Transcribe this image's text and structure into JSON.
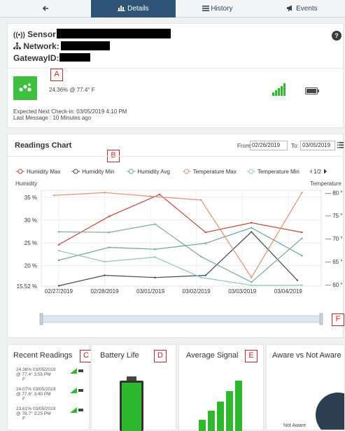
{
  "tabs": [
    {
      "label": "",
      "icon": "back-arrow-icon"
    },
    {
      "label": "Details",
      "icon": "bar-chart-icon"
    },
    {
      "label": "History",
      "icon": "list-icon"
    },
    {
      "label": "Events",
      "icon": "megaphone-icon"
    }
  ],
  "header": {
    "sensor_label": "Sensor:",
    "network_label": "Network:",
    "gateway_label": "GatewayID:",
    "help": "?"
  },
  "status": {
    "reading": "24.36% @ 77.4° F",
    "next_checkin": "Expected Next Check-in: 03/05/2019 4:10 PM",
    "last_message": "Last Message : 10 Minutes ago"
  },
  "markers": {
    "a": "A",
    "b": "B",
    "c": "C",
    "d": "D",
    "e": "E",
    "f": "F"
  },
  "chart_panel": {
    "title": "Readings Chart",
    "from_label": "From:",
    "from_value": "02/26/2019",
    "to_label": "To:",
    "to_value": "03/05/2019",
    "page": "1/2"
  },
  "chart_data": {
    "type": "line",
    "x": [
      "02/27/2019",
      "02/28/2019",
      "03/01/2019",
      "03/02/2019",
      "03/03/2019",
      "03/04/2019"
    ],
    "y_left_label": "Humidity",
    "y_left_ticks": [
      "15.52 %",
      "20 %",
      "25 %",
      "30 %",
      "35 %"
    ],
    "y_left_range": [
      15.52,
      36.5
    ],
    "y_right_label": "Temperature",
    "y_right_ticks": [
      "60 °F",
      "65 °F",
      "70 °F",
      "75 °F",
      "80 °F"
    ],
    "y_right_range": [
      59.7,
      80.5
    ],
    "series": [
      {
        "name": "Humidity Max",
        "axis": "left",
        "color": "#c8473c",
        "points": [
          [
            0,
            24.6
          ],
          [
            1.1,
            30.8
          ],
          [
            2.2,
            35.6
          ],
          [
            3.2,
            27.3
          ],
          [
            4.2,
            29.4
          ],
          [
            5.3,
            27.3
          ]
        ]
      },
      {
        "name": "Humidity Min",
        "axis": "left",
        "color": "#3c4a5a",
        "points": [
          [
            0,
            15.6
          ],
          [
            1,
            17.9
          ],
          [
            2.1,
            17.4
          ],
          [
            3.2,
            17.9
          ],
          [
            4.2,
            27.4
          ],
          [
            5.2,
            16.8
          ]
        ]
      },
      {
        "name": "Humidity Avg",
        "axis": "left",
        "color": "#6aa39a",
        "points": [
          [
            0,
            21.2
          ],
          [
            1.1,
            24
          ],
          [
            2.1,
            23.6
          ],
          [
            3.2,
            24.9
          ],
          [
            4.2,
            28.3
          ],
          [
            5.3,
            22.2
          ]
        ]
      },
      {
        "name": "Temperature Max",
        "axis": "right",
        "color": "#e09070",
        "points": [
          [
            -0.1,
            79.4
          ],
          [
            1,
            80
          ],
          [
            2,
            79.2
          ],
          [
            3.1,
            78.4
          ],
          [
            4.2,
            61.6
          ],
          [
            5.3,
            80
          ]
        ]
      },
      {
        "name": "Temperature Min",
        "axis": "right",
        "color": "#8fc7b8",
        "points": [
          [
            0,
            67.4
          ],
          [
            1,
            65
          ],
          [
            2.1,
            66
          ],
          [
            3.1,
            61.6
          ],
          [
            4.2,
            59.9
          ],
          [
            5.3,
            59.9
          ]
        ]
      },
      {
        "name": "",
        "axis": "left",
        "color": "#7fa8a0",
        "points": [
          [
            0,
            27.4
          ],
          [
            1.1,
            27.3
          ],
          [
            2.1,
            29.1
          ],
          [
            3.1,
            22
          ],
          [
            4.2,
            16.4
          ],
          [
            5.3,
            26
          ]
        ]
      }
    ]
  },
  "recent": {
    "title": "Recent Readings",
    "rows": [
      {
        "line1": "24.36% 03/05/2019",
        "line2": "@ 77.4°  3:55 PM",
        "line3": "F"
      },
      {
        "line1": "24.07% 03/05/2019",
        "line2": "@ 77.6°  3:40 PM",
        "line3": "F"
      },
      {
        "line1": "23.61% 03/05/2019",
        "line2": "@ 78.7°  3:25 PM",
        "line3": "F"
      }
    ]
  },
  "battery": {
    "title": "Battery Life",
    "level": 1.0,
    "color": "#2eb82e"
  },
  "signal": {
    "title": "Average Signal",
    "bars": 5,
    "color": "#2eb82e"
  },
  "aware": {
    "title": "Aware vs Not Aware",
    "not_aware_label": "Not Aware"
  }
}
